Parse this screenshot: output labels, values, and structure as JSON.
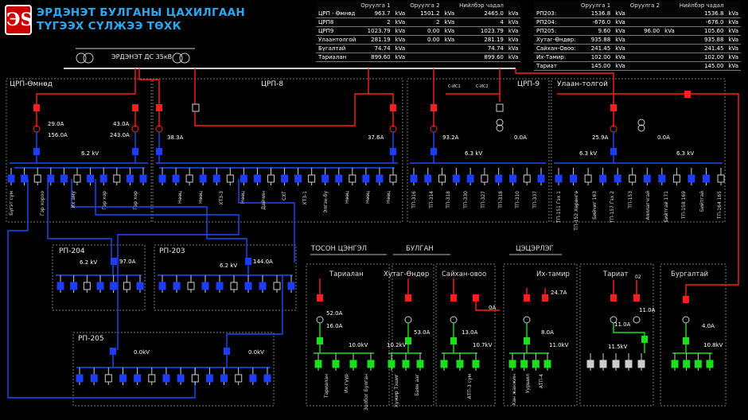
{
  "header": {
    "logo_text": "ЭS",
    "title_line1": "ЭРДЭНЭТ БУЛГАНЫ ЦАХИЛГААН",
    "title_line2": "ТҮГЭЭХ СҮЛЖЭЭ ТӨХК"
  },
  "table_left": {
    "headers": [
      "",
      "Оруулга 1",
      "Оруулга 2",
      "Нийлбэр чадал"
    ],
    "rows": [
      [
        "ЦРП - Өмнөд",
        "963.7",
        "kVa",
        "1501.2",
        "kVa",
        "2465.0",
        "kVa"
      ],
      [
        "ЦРП8",
        "2",
        "kVa",
        "2",
        "kVa",
        "4",
        "kVa"
      ],
      [
        "ЦРП9",
        "1023.79",
        "kVa",
        "0.00",
        "kVa",
        "1023.79",
        "kVa"
      ],
      [
        "Улаантолгой",
        "281.19",
        "kVa",
        "0.00",
        "kVa",
        "281.19",
        "kVa"
      ],
      [
        "Бүгалтай",
        "74.74",
        "kVa",
        "",
        "",
        "74.74",
        "kVa"
      ],
      [
        "Тариалан",
        "899.60",
        "kVa",
        "",
        "",
        "899.60",
        "kVa"
      ]
    ]
  },
  "table_right": {
    "headers": [
      "",
      "Оруулга 1",
      "Оруулга 2",
      "Нийлбэр чадал"
    ],
    "rows": [
      [
        "РП203:",
        "1536.8",
        "kVa",
        "",
        "",
        "1536.8",
        "kVa"
      ],
      [
        "РП204:",
        "-676.0",
        "kVa",
        "",
        "",
        "-676.0",
        "kVa"
      ],
      [
        "РП205:",
        "9.60",
        "kVa",
        "96.00",
        "kVa",
        "105.60",
        "kVa"
      ],
      [
        "Хутаг-Өндөр:",
        "935.88",
        "kVa",
        "",
        "",
        "935.88",
        "kVa"
      ],
      [
        "Сайхан-Овоо:",
        "241.45",
        "kVa",
        "",
        "",
        "241.45",
        "kVa"
      ],
      [
        "Их-Тамир:",
        "102.00",
        "kVa",
        "",
        "",
        "102.00",
        "kVa"
      ],
      [
        "Тариат",
        "145.00",
        "kVa",
        "",
        "",
        "145.00",
        "kVa"
      ]
    ]
  },
  "source": {
    "label": "ЭРДЭНЭТ ДС 35кВ"
  },
  "sections": {
    "crp_omnod": "ЦРП-Өмнөд",
    "crp8": "ЦРП-8",
    "crp9": "ЦРП-9",
    "ulaan_tolgoi": "Улаан-толгой",
    "rp204": "РП-204",
    "rp203": "РП-203",
    "rp205": "РП-205",
    "toson_tsengel": "ТОСОН ЦЭНГЭЛ",
    "bulgan": "БУЛГАН",
    "tsetserleg": "ЦЭЦЭРЛЭГ"
  },
  "substations": {
    "tarialan": "Тариалан",
    "khutag_undur": "Хутаг-Өндөр",
    "saikhan_ovoo": "Сайхан-овоо",
    "ikh_tamir": "Их-тамир",
    "tariat": "Тариат",
    "burgaltai": "Бургалтай"
  },
  "readings": {
    "omnod_i1": "29.0A",
    "omnod_i2": "156.0A",
    "omnod_i3": "43.0A",
    "omnod_i4": "243.0A",
    "omnod_kv": "6.2 kV",
    "crp8_i1": "38.3A",
    "crp8_i2": "37.6A",
    "crp9_i1": "93.2A",
    "crp9_kv": "6.3 kV",
    "crp9_i2": "0.0A",
    "ut_i1": "25.9A",
    "ut_kv1": "6.3 kV",
    "ut_i2": "0.0A",
    "ut_kv2": "6.3 kV",
    "rp204_kv": "6.2 kV",
    "rp204_i": "97.0A",
    "rp203_kv": "6.2 kV",
    "rp203_i": "144.0A",
    "rp205_kv1": "0.0kV",
    "rp205_kv2": "0.0kV",
    "tarialan_i1": "52.0A",
    "tarialan_i2": "16.0A",
    "tarialan_kv": "10.0kV",
    "khutag_i": "53.0A",
    "khutag_kv": "10.2kV",
    "saikhan_i": "13.0A",
    "saikhan_kv": "10.7kV",
    "saikhan_i2": "0A",
    "ikh_i1": "24.7A",
    "ikh_i2": "8.0A",
    "ikh_kv": "11.0kV",
    "tariat_i1": "11.0A",
    "tariat_i2": "11.0A",
    "tariat_kv": "11.5kV",
    "tariat_num": "02",
    "burg_i": "4.0A",
    "burg_kv": "10.8kV",
    "crp9_feed1": "С-ИС1",
    "crp9_feed2": "С-ИС2"
  },
  "feeder_labels": {
    "omnod": [
      "Бүгэт сүм",
      "Гэр хороо",
      "Их аму",
      "Гэр хор",
      "Гэр хор"
    ],
    "crp8": [
      "Нөөц",
      "Нөөц",
      "ХТЗ-3",
      "Нөөц",
      "Дайчин",
      "СХГ",
      "ХТ3-1",
      "Элгэн-бу",
      "Нөөц",
      "Нөөц",
      "Нөөц"
    ],
    "crp9": [
      "ТП-316",
      "ТП-314",
      "ТП-318",
      "ТП-330",
      "ТП-327",
      "ТП-318",
      "ТП-310",
      "ТП-337"
    ],
    "ut": [
      "ТП-151 Гэх 1",
      "ТП-152 Хөрөнгө",
      "Бийчиг 163",
      "ТП-157 Гэх 2",
      "ТП-153",
      "Аяллагчгай",
      "Бийтгай 171",
      "ТП-158 169",
      "Бийтгай",
      "ТП-164 165"
    ],
    "south": [
      "Тариалан",
      "Их гүүр",
      "Золбог Булган",
      "Хужир Тэшиг",
      "Баян ааг",
      "АТП-3 сүм",
      "Хан жанжин",
      "Ууршил",
      "АТП-4"
    ]
  },
  "colors": {
    "live": "#ff1e1e",
    "breaker_closed": "#ff1e1e",
    "breaker_6kv": "#1c3cff",
    "breaker_10kv": "#19e01b",
    "bus_blue": "#1e4bff",
    "bus_green": "#19e01b",
    "frame": "#777777",
    "title": "#2aa8f0"
  }
}
